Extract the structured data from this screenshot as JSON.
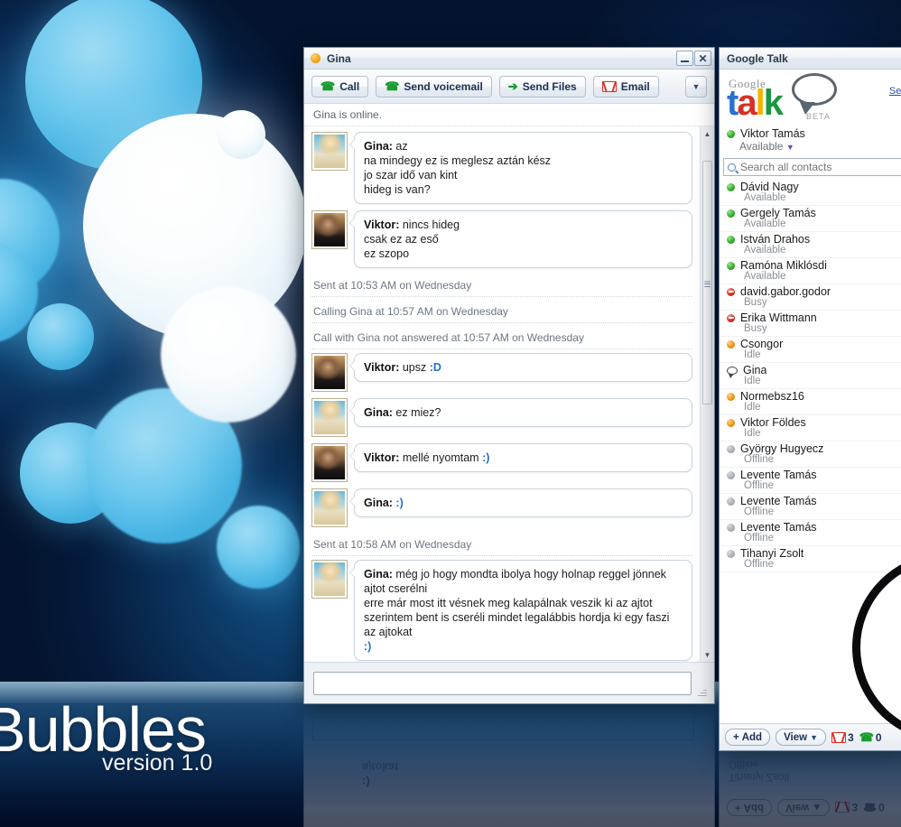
{
  "desktop": {
    "wallpaper_title": "Bubbles",
    "wallpaper_version": "version 1.0",
    "accent_blue": "#1566b4",
    "bubble_blue": "#6cc8ee",
    "bubble_white": "#ffffff"
  },
  "chat_window": {
    "title": "Gina",
    "presence_icon": "orange-status-icon",
    "minimize_label": "–",
    "close_label": "✕",
    "status_line": "Gina is online.",
    "toolbar": [
      {
        "label": "Call",
        "icon": "phone-icon"
      },
      {
        "label": "Send voicemail",
        "icon": "phone-icon"
      },
      {
        "label": "Send Files",
        "icon": "send-files-icon"
      },
      {
        "label": "Email",
        "icon": "gmail-icon"
      }
    ],
    "toolbar_overflow": "▼",
    "scroll_up_arrow": "▲",
    "scroll_down_arrow": "▼",
    "input_value": "",
    "input_placeholder": "",
    "messages": [
      {
        "kind": "message",
        "sender": "Gina",
        "avatar": "gina",
        "lines": [
          {
            "text": "az"
          },
          {
            "text": "na mindegy ez is meglesz aztán kész"
          },
          {
            "text": "jo szar idő van kint"
          },
          {
            "text": "hideg is van?"
          }
        ]
      },
      {
        "kind": "message",
        "sender": "Viktor",
        "avatar": "viktor",
        "lines": [
          {
            "text": "nincs hideg"
          },
          {
            "text": "csak ez az eső"
          },
          {
            "text": "ez szopo"
          }
        ]
      },
      {
        "kind": "system",
        "text": "Sent at 10:53 AM on Wednesday"
      },
      {
        "kind": "system",
        "text": "Calling Gina at 10:57 AM on Wednesday"
      },
      {
        "kind": "system",
        "text": "Call with Gina not answered at 10:57 AM on Wednesday"
      },
      {
        "kind": "message",
        "sender": "Viktor",
        "avatar": "viktor",
        "lines": [
          {
            "text": "upsz ",
            "emoticon": ":D"
          }
        ]
      },
      {
        "kind": "message",
        "sender": "Gina",
        "avatar": "gina",
        "lines": [
          {
            "text": "ez miez?"
          }
        ]
      },
      {
        "kind": "message",
        "sender": "Viktor",
        "avatar": "viktor",
        "lines": [
          {
            "text": "mellé nyomtam ",
            "emoticon": ":)"
          }
        ]
      },
      {
        "kind": "message",
        "sender": "Gina",
        "avatar": "gina",
        "lines": [
          {
            "text": "",
            "emoticon": ":)"
          }
        ]
      },
      {
        "kind": "system",
        "text": "Sent at 10:58 AM on Wednesday"
      },
      {
        "kind": "message",
        "sender": "Gina",
        "avatar": "gina",
        "lines": [
          {
            "text": "még jo hogy mondta ibolya hogy holnap reggel jönnek ajtot cserélni"
          },
          {
            "text": "erre már most itt vésnek meg kalapálnak veszik ki az ajtot"
          },
          {
            "text": "szerintem bent is cseréli mindet legalábbis hordja ki egy faszi az ajtokat"
          },
          {
            "text": "",
            "emoticon": ":)"
          }
        ]
      }
    ]
  },
  "gtalk": {
    "window_title": "Google Talk",
    "settings_link": "Settin",
    "logo": {
      "google": "Google",
      "t": "t",
      "a": "a",
      "l": "l",
      "k": "k",
      "beta": "BETA"
    },
    "me": {
      "name": "Viktor Tamás",
      "status": "Available",
      "presence": "available",
      "caret": "▼"
    },
    "search_placeholder": "Search all contacts",
    "search_value": "",
    "contacts": [
      {
        "name": "Dávid Nagy",
        "status": "Available",
        "presence": "available"
      },
      {
        "name": "Gergely Tamás",
        "status": "Available",
        "presence": "available"
      },
      {
        "name": "István Drahos",
        "status": "Available",
        "presence": "available"
      },
      {
        "name": "Ramóna Miklósdi",
        "status": "Available",
        "presence": "available"
      },
      {
        "name": "david.gabor.godor",
        "status": "Busy",
        "presence": "busy"
      },
      {
        "name": "Erika Wittmann",
        "status": "Busy",
        "presence": "busy"
      },
      {
        "name": "Csongor",
        "status": "Idle",
        "presence": "idle"
      },
      {
        "name": "Gina",
        "status": "Idle",
        "presence": "chat"
      },
      {
        "name": "Normebsz16",
        "status": "Idle",
        "presence": "idle"
      },
      {
        "name": "Viktor Földes",
        "status": "Idle",
        "presence": "idle"
      },
      {
        "name": "György Hugyecz",
        "status": "Offline",
        "presence": "offline"
      },
      {
        "name": "Levente Tamás",
        "status": "Offline",
        "presence": "offline"
      },
      {
        "name": "Levente Tamás",
        "status": "Offline",
        "presence": "offline"
      },
      {
        "name": "Levente Tamás",
        "status": "Offline",
        "presence": "offline"
      },
      {
        "name": "Tihanyi Zsolt",
        "status": "Offline",
        "presence": "offline"
      }
    ],
    "bottom": {
      "add_label": "Add",
      "add_plus": "+",
      "view_label": "View",
      "view_caret": "▼",
      "mail_count": "3",
      "call_count": "0",
      "mail_icon": "gmail-icon",
      "call_icon": "phone-icon"
    }
  },
  "reflection": {
    "add_label": "Add",
    "add_plus": "+",
    "view_label": "View",
    "view_caret": "▲",
    "mail_count": "3",
    "call_count": "0",
    "name": "Tihanyi Zsolt",
    "status": "Offline",
    "emoticon": ":)",
    "sent_text": "ajtokat"
  }
}
